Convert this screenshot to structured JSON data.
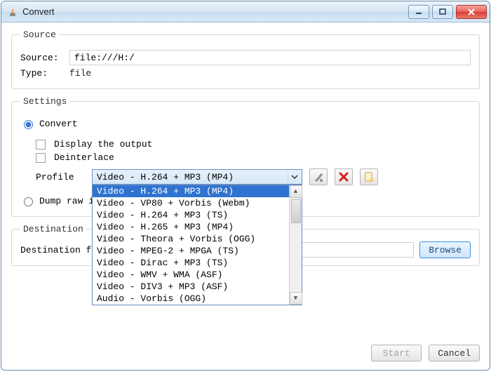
{
  "window": {
    "title": "Convert"
  },
  "source": {
    "legend": "Source",
    "source_label": "Source:",
    "source_value": "file:///H:/",
    "type_label": "Type:",
    "type_value": "file"
  },
  "settings": {
    "legend": "Settings",
    "convert_label": "Convert",
    "display_output_label": "Display the output",
    "deinterlace_label": "Deinterlace",
    "profile_label": "Profile",
    "profile_selected": "Video - H.264 + MP3 (MP4)",
    "profile_options": [
      "Video - H.264 + MP3 (MP4)",
      "Video - VP80 + Vorbis (Webm)",
      "Video - H.264 + MP3 (TS)",
      "Video - H.265 + MP3 (MP4)",
      "Video - Theora + Vorbis (OGG)",
      "Video - MPEG-2 + MPGA (TS)",
      "Video - Dirac + MP3 (TS)",
      "Video - WMV + WMA (ASF)",
      "Video - DIV3 + MP3 (ASF)",
      "Audio - Vorbis (OGG)"
    ],
    "dump_raw_label": "Dump raw input"
  },
  "destination": {
    "legend": "Destination",
    "file_label": "Destination file:",
    "browse_label": "Browse"
  },
  "footer": {
    "start_label": "Start",
    "cancel_label": "Cancel"
  },
  "icons": {
    "edit": "edit-profile-icon",
    "delete": "delete-profile-icon",
    "new": "new-profile-icon"
  }
}
